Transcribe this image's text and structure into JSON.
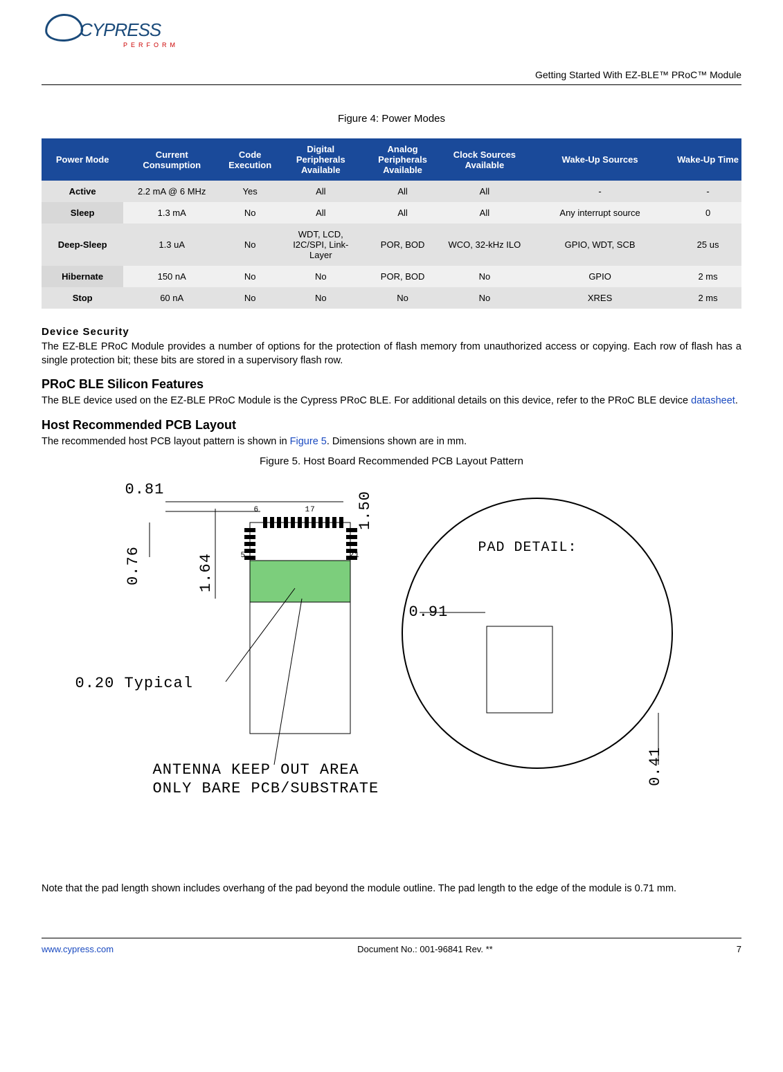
{
  "header": {
    "logo_main": "CYPRESS",
    "logo_tag": "PERFORM",
    "doc_title": "Getting Started With EZ-BLE™ PRoC™ Module"
  },
  "figure4_caption": "Figure 4:  Power Modes",
  "table": {
    "headers": [
      "Power Mode",
      "Current Consumption",
      "Code Execution",
      "Digital Peripherals Available",
      "Analog Peripherals Available",
      "Clock Sources Available",
      "Wake-Up Sources",
      "Wake-Up Time"
    ],
    "rows": [
      [
        "Active",
        "2.2 mA @ 6 MHz",
        "Yes",
        "All",
        "All",
        "All",
        "-",
        "-"
      ],
      [
        "Sleep",
        "1.3 mA",
        "No",
        "All",
        "All",
        "All",
        "Any interrupt source",
        "0"
      ],
      [
        "Deep-Sleep",
        "1.3 uA",
        "No",
        "WDT, LCD, I2C/SPI, Link-Layer",
        "POR, BOD",
        "WCO, 32-kHz ILO",
        "GPIO, WDT, SCB",
        "25 us"
      ],
      [
        "Hibernate",
        "150 nA",
        "No",
        "No",
        "POR, BOD",
        "No",
        "GPIO",
        "2 ms"
      ],
      [
        "Stop",
        "60 nA",
        "No",
        "No",
        "No",
        "No",
        "XRES",
        "2 ms"
      ]
    ]
  },
  "sec1_h": "Device Security",
  "sec1_p": "The EZ-BLE PRoC Module provides a number of options for the protection of flash memory from unauthorized access or copying. Each row of flash has a single protection bit; these bits are stored in a supervisory flash row.",
  "sec2_h": "PRoC BLE Silicon Features",
  "sec2_p1": "The BLE device used on the EZ-BLE PRoC Module is the Cypress PRoC BLE.  For additional details on this device, refer to the PRoC BLE device ",
  "sec2_link": "datasheet",
  "sec2_p2": ".",
  "sec3_h": "Host Recommended PCB Layout",
  "sec3_p1": "The recommended host PCB layout pattern is shown in ",
  "sec3_link": "Figure 5",
  "sec3_p2": ". Dimensions shown are in mm.",
  "figure5_caption": "Figure 5. Host Board Recommended PCB Layout Pattern",
  "fig5": {
    "d1": "0.81",
    "d2": "0.76",
    "d3": "1.64",
    "d4": "1.50",
    "d5": "0.91",
    "d6": "0.41",
    "n6": "6",
    "n17": "17",
    "n5": "5",
    "n21": "21",
    "typ": "0.20 Typical",
    "pad": "PAD DETAIL:",
    "ant1": "ANTENNA KEEP OUT AREA",
    "ant2": "ONLY BARE PCB/SUBSTRATE"
  },
  "note": "Note that the pad length shown includes overhang of the pad beyond the module outline. The pad length to the edge of the module is 0.71 mm.",
  "footer": {
    "left": "www.cypress.com",
    "center": "Document No.: 001-96841 Rev. **",
    "right": "7"
  },
  "chart_data": {
    "type": "table",
    "title": "Power Modes",
    "columns": [
      "Power Mode",
      "Current Consumption",
      "Code Execution",
      "Digital Peripherals Available",
      "Analog Peripherals Available",
      "Clock Sources Available",
      "Wake-Up Sources",
      "Wake-Up Time"
    ],
    "rows": [
      {
        "Power Mode": "Active",
        "Current Consumption": "2.2 mA @ 6 MHz",
        "Code Execution": "Yes",
        "Digital Peripherals Available": "All",
        "Analog Peripherals Available": "All",
        "Clock Sources Available": "All",
        "Wake-Up Sources": "-",
        "Wake-Up Time": "-"
      },
      {
        "Power Mode": "Sleep",
        "Current Consumption": "1.3 mA",
        "Code Execution": "No",
        "Digital Peripherals Available": "All",
        "Analog Peripherals Available": "All",
        "Clock Sources Available": "All",
        "Wake-Up Sources": "Any interrupt source",
        "Wake-Up Time": "0"
      },
      {
        "Power Mode": "Deep-Sleep",
        "Current Consumption": "1.3 uA",
        "Code Execution": "No",
        "Digital Peripherals Available": "WDT, LCD, I2C/SPI, Link-Layer",
        "Analog Peripherals Available": "POR, BOD",
        "Clock Sources Available": "WCO, 32-kHz ILO",
        "Wake-Up Sources": "GPIO, WDT, SCB",
        "Wake-Up Time": "25 us"
      },
      {
        "Power Mode": "Hibernate",
        "Current Consumption": "150 nA",
        "Code Execution": "No",
        "Digital Peripherals Available": "No",
        "Analog Peripherals Available": "POR, BOD",
        "Clock Sources Available": "No",
        "Wake-Up Sources": "GPIO",
        "Wake-Up Time": "2 ms"
      },
      {
        "Power Mode": "Stop",
        "Current Consumption": "60 nA",
        "Code Execution": "No",
        "Digital Peripherals Available": "No",
        "Analog Peripherals Available": "No",
        "Clock Sources Available": "No",
        "Wake-Up Sources": "XRES",
        "Wake-Up Time": "2 ms"
      }
    ]
  }
}
